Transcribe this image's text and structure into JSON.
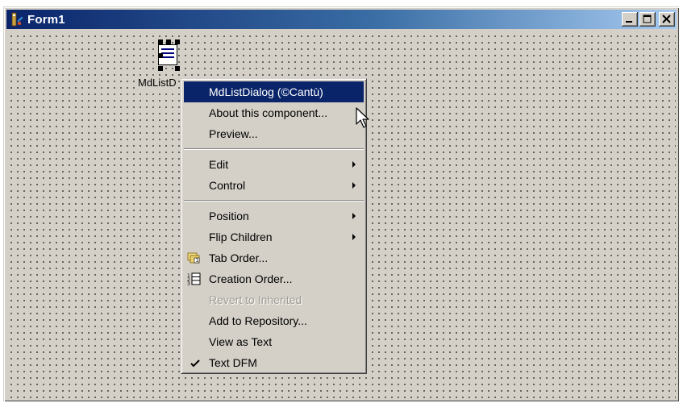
{
  "window": {
    "title": "Form1",
    "icons": {
      "app": "delphi-form-icon",
      "minimize": "minimize-icon",
      "maximize": "maximize-icon",
      "close": "close-icon"
    }
  },
  "component": {
    "label": "MdListD",
    "icon": "list-dialog-component-icon"
  },
  "context_menu": {
    "items": [
      {
        "label": "MdListDialog (©Cantù)",
        "highlighted": true
      },
      {
        "label": "About this component..."
      },
      {
        "label": "Preview..."
      },
      {
        "label": "Edit",
        "submenu": true
      },
      {
        "label": "Control",
        "submenu": true
      },
      {
        "label": "Position",
        "submenu": true
      },
      {
        "label": "Flip Children",
        "submenu": true
      },
      {
        "label": "Tab Order...",
        "icon": "tab-order-icon"
      },
      {
        "label": "Creation Order...",
        "icon": "creation-order-icon"
      },
      {
        "label": "Revert to Inherited",
        "disabled": true
      },
      {
        "label": "Add to Repository..."
      },
      {
        "label": "View as Text"
      },
      {
        "label": "Text DFM",
        "checked": true
      }
    ]
  },
  "colors": {
    "face": "#d4d0c8",
    "highlight": "#0a246a",
    "title_gradient_start": "#0a246a",
    "title_gradient_end": "#a6caf0"
  }
}
